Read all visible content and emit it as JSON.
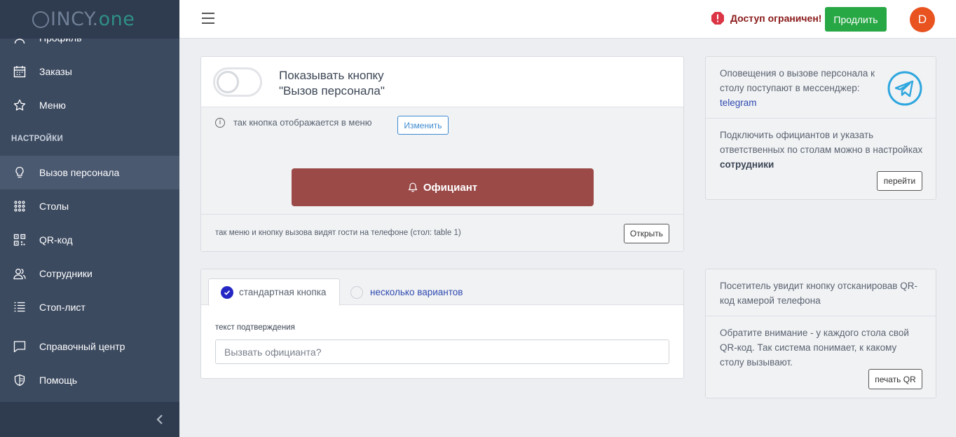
{
  "app": {
    "logo_text": "INCY.",
    "logo_accent": "one"
  },
  "sidebar": {
    "items_top": [
      {
        "label": "Профиль",
        "icon": "user-icon"
      },
      {
        "label": "Заказы",
        "icon": "calendar-icon"
      },
      {
        "label": "Меню",
        "icon": "star-icon"
      }
    ],
    "section_label": "НАСТРОЙКИ",
    "items_settings": [
      {
        "label": "Вызов персонала",
        "icon": "lightbulb-icon",
        "active": true
      },
      {
        "label": "Столы",
        "icon": "grid-icon"
      },
      {
        "label": "QR-код",
        "icon": "qr-icon"
      },
      {
        "label": "Сотрудники",
        "icon": "users-icon"
      },
      {
        "label": "Стоп-лист",
        "icon": "list-icon"
      }
    ],
    "items_bottom": [
      {
        "label": "Справочный центр",
        "icon": "chat-icon"
      },
      {
        "label": "Помощь",
        "icon": "shield-icon"
      }
    ]
  },
  "topbar": {
    "alert_text": "Доступ ограничен!",
    "renew_label": "Продлить",
    "avatar_letter": "D",
    "colors": {
      "alert": "#dc3545",
      "renew": "#28a745",
      "avatar": "#e8531f"
    }
  },
  "staff_call": {
    "title_line1": "Показывать кнопку",
    "title_line2": "\"Вызов персонала\"",
    "toggle_on": false,
    "info_text": "так кнопка отображается в меню",
    "change_label": "Изменить",
    "waiter_button_label": "Официант",
    "waiter_button_color": "#9b4a48",
    "footer_text": "так меню и кнопку вызова видят гости на телефоне (стол: table 1)",
    "open_label": "Открыть"
  },
  "button_mode": {
    "tab_standard": "стандартная кнопка",
    "tab_variants": "несколько вариантов",
    "selected": "standard",
    "confirm_label": "текст подтверждения",
    "confirm_placeholder": "Вызвать официанта?"
  },
  "notify_panel": {
    "text_prefix": "Оповещения о вызове персонала к столу поступают в мессенджер:",
    "messenger_link": "telegram",
    "staff_text_prefix": "Подключить официантов и указать ответственных по столам можно в настройках",
    "staff_text_bold": "сотрудники",
    "go_label": "перейти"
  },
  "qr_panel": {
    "text1": "Посетитель увидит кнопку отсканировав QR-код камерой телефона",
    "text2": "Обратите внимание - у каждого стола свой QR-код. Так система понимает, к какому столу вызывают.",
    "print_label": "печать QR"
  }
}
